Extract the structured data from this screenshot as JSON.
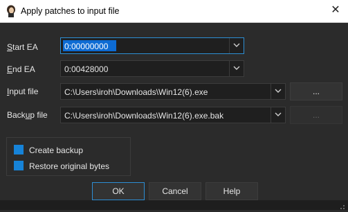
{
  "window": {
    "title": "Apply patches to input file",
    "close_glyph": "✕"
  },
  "fields": {
    "start_ea": {
      "label_pre": "",
      "label_ul": "S",
      "label_post": "tart EA",
      "value": "0:00000000"
    },
    "end_ea": {
      "label_pre": "",
      "label_ul": "E",
      "label_post": "nd EA",
      "value": "0:00428000"
    },
    "input_file": {
      "label_pre": "",
      "label_ul": "I",
      "label_post": "nput file",
      "value": "C:\\Users\\iroh\\Downloads\\Win12(6).exe",
      "browse_label": "..."
    },
    "backup_file": {
      "label_pre": "Back",
      "label_ul": "u",
      "label_post": "p file",
      "value": "C:\\Users\\iroh\\Downloads\\Win12(6).exe.bak",
      "browse_label": "..."
    }
  },
  "options": {
    "create_backup": {
      "label": "Create backup",
      "checked": true
    },
    "restore_original": {
      "label": "Restore original bytes",
      "checked": true
    }
  },
  "buttons": {
    "ok": "OK",
    "cancel": "Cancel",
    "help": "Help"
  },
  "colors": {
    "accent": "#1683d8",
    "background": "#2b2b2b",
    "field": "#1f1f1f"
  },
  "icons": {
    "app": "ida-app-icon",
    "dropdown": "chevron-down-icon",
    "close": "close-icon",
    "grip": "resize-grip-icon"
  }
}
